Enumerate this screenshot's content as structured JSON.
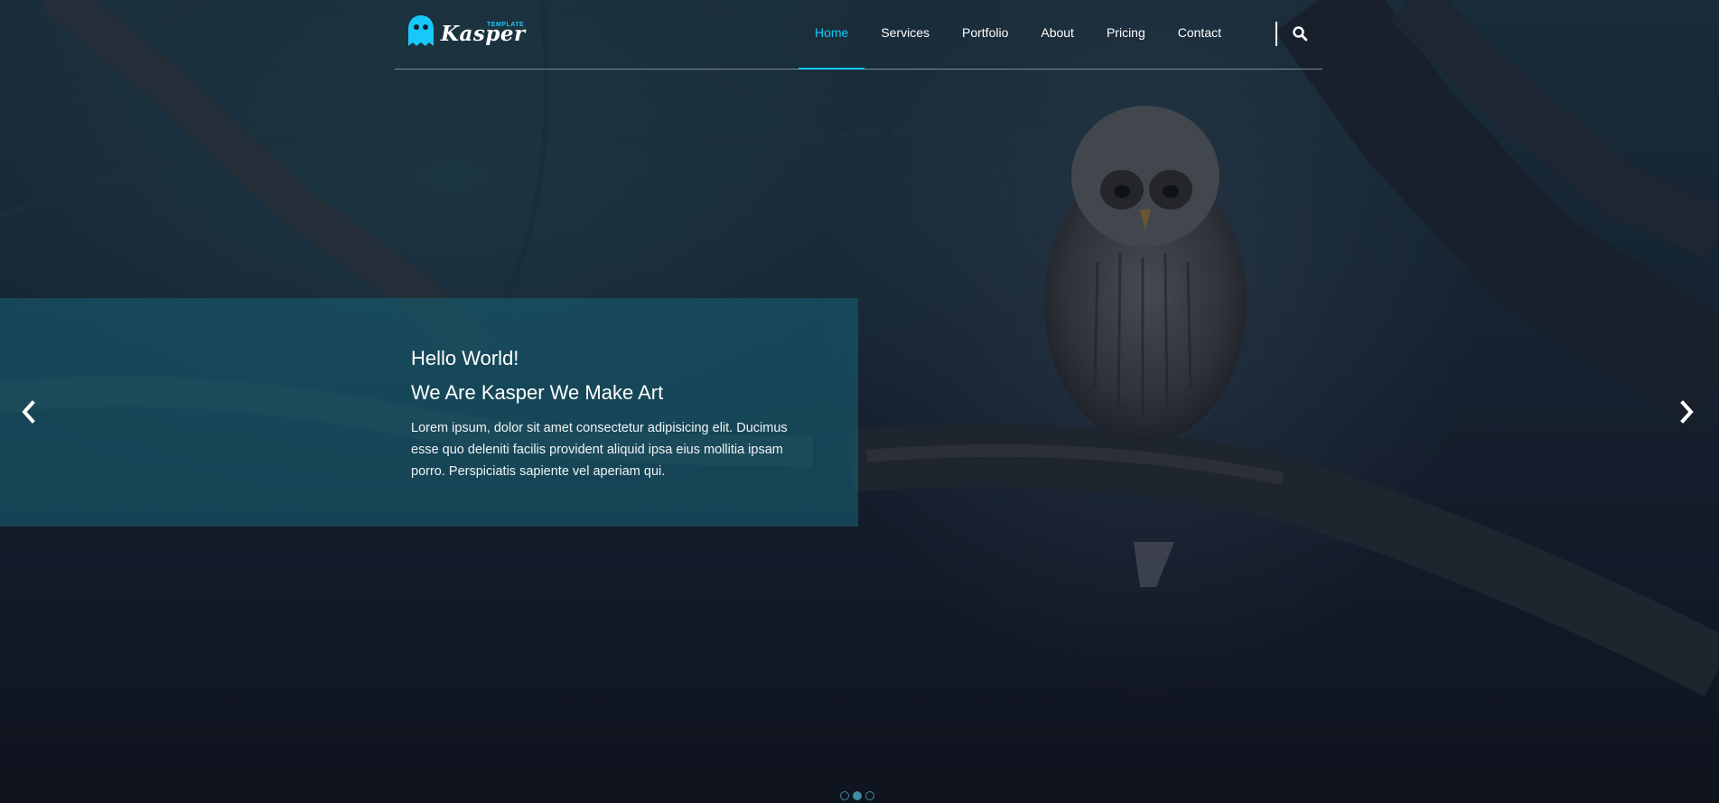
{
  "brand": {
    "name": "Kasper",
    "tag": "TEMPLATE",
    "accent_color": "#19c8fa"
  },
  "nav": {
    "items": [
      {
        "label": "Home",
        "active": true
      },
      {
        "label": "Services",
        "active": false
      },
      {
        "label": "Portfolio",
        "active": false
      },
      {
        "label": "About",
        "active": false
      },
      {
        "label": "Pricing",
        "active": false
      },
      {
        "label": "Contact",
        "active": false
      }
    ],
    "search_icon": "search-icon"
  },
  "slide": {
    "heading_line1": "Hello World!",
    "heading_line2": "We Are Kasper We Make Art",
    "text": "Lorem ipsum, dolor sit amet consectetur adipisicing elit. Ducimus esse quo deleniti facilis provident aliquid ipsa eius mollitia ipsam porro. Perspiciatis sapiente vel aperiam qui.",
    "prev_icon": "chevron-left-icon",
    "next_icon": "chevron-right-icon",
    "bullet_count": 3,
    "active_bullet": 2
  }
}
